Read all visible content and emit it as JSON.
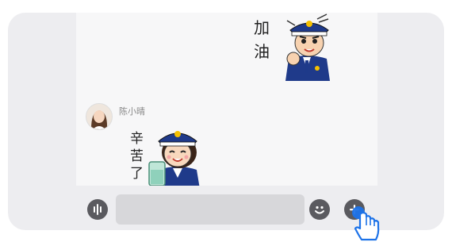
{
  "chat": {
    "sticker_top": {
      "text_line1": "加",
      "text_line2": "油"
    },
    "message": {
      "sender_name": "陈小晴",
      "sticker": {
        "text_line1": "辛",
        "text_line2": "苦",
        "text_line3": "了"
      }
    }
  },
  "toolbar": {
    "voice_icon": "voice-wave-icon",
    "input_value": "",
    "emoji_icon": "smiley-icon",
    "plus_icon": "plus-icon"
  },
  "colors": {
    "card_bg": "#ededf0",
    "chat_bg": "#f7f7f8",
    "icon_gray": "#5a5a5f",
    "officer_navy": "#1f3a8a",
    "tap_hint_blue": "#1e73e8"
  }
}
